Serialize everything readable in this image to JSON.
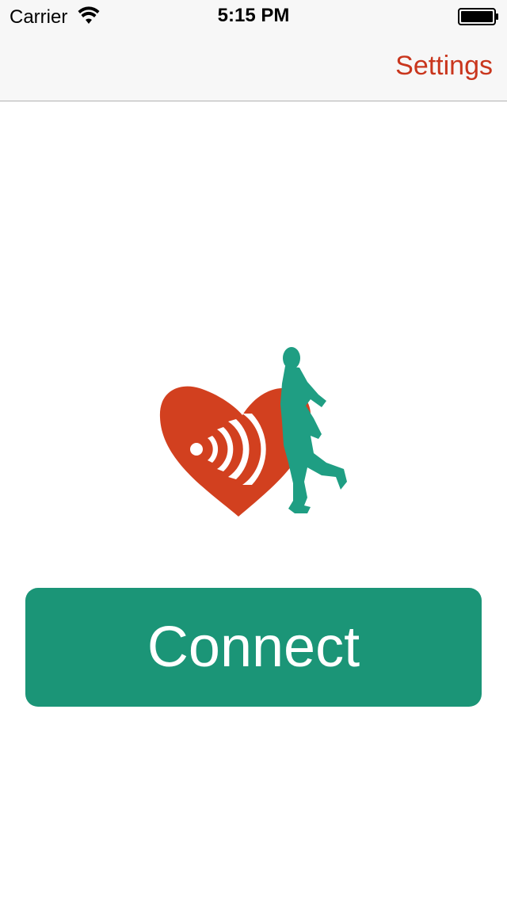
{
  "status_bar": {
    "carrier": "Carrier",
    "time": "5:15 PM",
    "wifi_icon": "wifi-icon",
    "battery_icon": "battery-icon"
  },
  "nav_bar": {
    "settings_label": "Settings",
    "accent_color": "#c9361d"
  },
  "logo": {
    "icon": "heart-runner-logo",
    "heart_color": "#d2401f",
    "runner_color": "#1f9e83"
  },
  "main": {
    "connect_label": "Connect",
    "button_color": "#1b9577"
  }
}
